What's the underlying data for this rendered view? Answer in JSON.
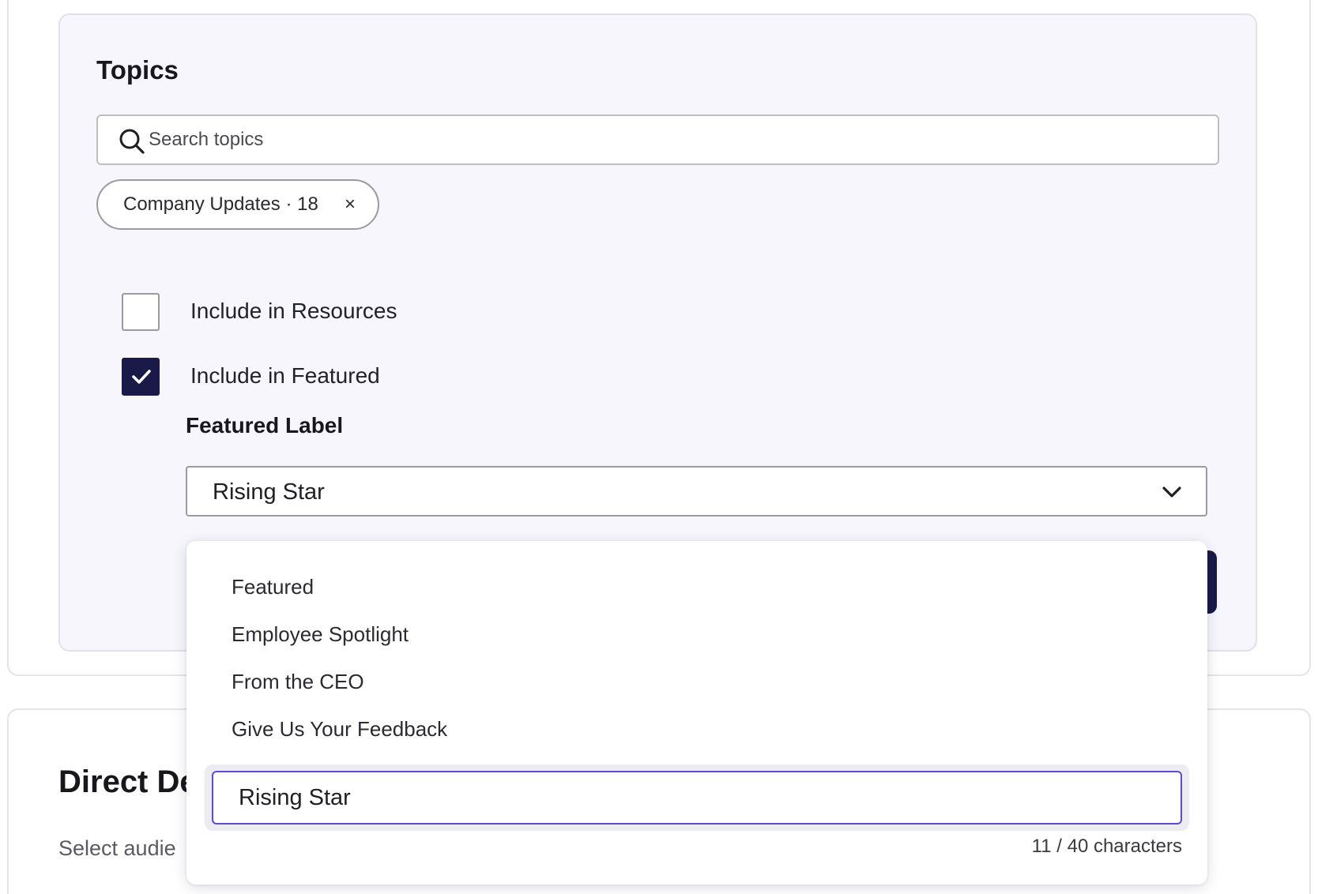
{
  "topics": {
    "title": "Topics",
    "search_placeholder": "Search topics",
    "chips": [
      {
        "label": "Company Updates · 18",
        "close": "×"
      }
    ],
    "checkboxes": [
      {
        "label": "Include in Resources",
        "checked": false
      },
      {
        "label": "Include in Featured",
        "checked": true
      }
    ],
    "featured_label": {
      "heading": "Featured Label",
      "selected_value": "Rising Star"
    }
  },
  "dropdown": {
    "options": [
      "Featured",
      "Employee Spotlight",
      "From the CEO",
      "Give Us Your Feedback"
    ],
    "custom_input_value": "Rising Star",
    "char_counter": "11 / 40 characters"
  },
  "direct": {
    "title": "Direct De",
    "subtitle": "Select audie"
  },
  "colors": {
    "accent_navy": "#1a1a48",
    "input_focus": "#5b4bd6",
    "panel_bg": "#f6f6fc"
  }
}
